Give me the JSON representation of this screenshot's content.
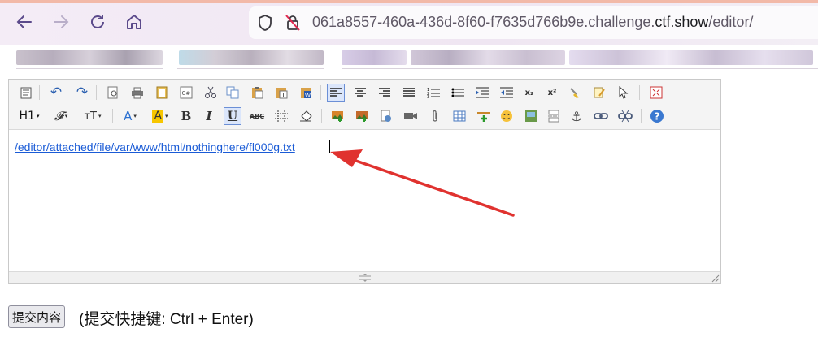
{
  "browser": {
    "url_prefix": "061a8557-460a-436d-8f60-f7635d766b9e.challenge.",
    "url_domain": "ctf.show",
    "url_path": "/editor/"
  },
  "editor": {
    "content_link": "/editor/attached/file/var/www/html/nothinghere/fl000g.txt",
    "toolbar_row1": [
      "source-icon",
      "undo-icon",
      "redo-icon",
      "preview-icon",
      "print-icon",
      "template-icon",
      "code-icon",
      "cut-icon",
      "copy-icon",
      "paste-icon",
      "paste-text-icon",
      "paste-word-icon",
      "align-left-icon",
      "align-center-icon",
      "align-right-icon",
      "justify-icon",
      "ordered-list-icon",
      "unordered-list-icon",
      "indent-icon",
      "outdent-icon",
      "subscript-icon",
      "superscript-icon",
      "clear-format-icon",
      "quick-format-icon",
      "select-all-icon",
      "fullscreen-icon"
    ],
    "toolbar_row2": [
      "heading-icon",
      "font-family-icon",
      "font-size-icon",
      "font-color-icon",
      "highlight-color-icon",
      "bold-icon",
      "italic-icon",
      "underline-icon",
      "strikethrough-icon",
      "line-height-icon",
      "remove-format-icon",
      "image-icon",
      "multi-image-icon",
      "flash-icon",
      "media-icon",
      "attachment-icon",
      "table-icon",
      "horizontal-rule-icon",
      "emoticon-icon",
      "baidu-map-icon",
      "page-break-icon",
      "anchor-icon",
      "link-icon",
      "unlink-icon",
      "help-icon"
    ],
    "labels": {
      "heading": "H1",
      "font_family": "𝓕",
      "font_size": "тT",
      "font_color": "A",
      "highlight": "A",
      "bold": "B",
      "italic": "I",
      "underline": "U",
      "strike": "ABC",
      "subscript": "x₂",
      "superscript": "x²",
      "undo": "↶",
      "redo": "↷",
      "help": "?"
    },
    "colors": {
      "link": "#1a5bd6",
      "arrow": "#e0322f",
      "active": "#dbe6fb"
    }
  },
  "form": {
    "submit_label": "提交内容",
    "hint": "(提交快捷键: Ctrl + Enter)"
  }
}
